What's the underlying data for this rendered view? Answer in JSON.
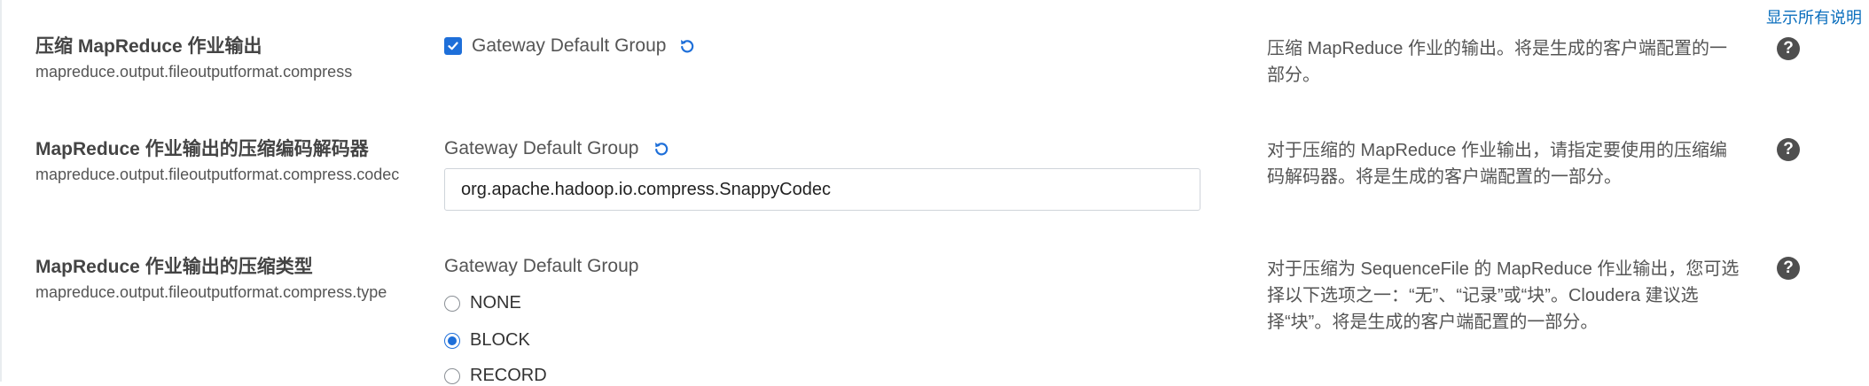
{
  "top_link": "显示所有说明",
  "colors": {
    "accent": "#1e6fd9",
    "link": "#0a6ebd",
    "help_icon": "#4f4f4f"
  },
  "rows": [
    {
      "title": "压缩 MapReduce 作业输出",
      "key": "mapreduce.output.fileoutputformat.compress",
      "group": "Gateway Default Group",
      "control": "checkbox",
      "checked": true,
      "description": "压缩 MapReduce 作业的输出。将是生成的客户端配置的一部分。"
    },
    {
      "title": "MapReduce 作业输出的压缩编码解码器",
      "key": "mapreduce.output.fileoutputformat.compress.codec",
      "group": "Gateway Default Group",
      "control": "text",
      "value": "org.apache.hadoop.io.compress.SnappyCodec",
      "description": "对于压缩的 MapReduce 作业输出，请指定要使用的压缩编码解码器。将是生成的客户端配置的一部分。"
    },
    {
      "title": "MapReduce 作业输出的压缩类型",
      "key": "mapreduce.output.fileoutputformat.compress.type",
      "group": "Gateway Default Group",
      "control": "radio",
      "options": [
        "NONE",
        "BLOCK",
        "RECORD"
      ],
      "selected": "BLOCK",
      "description": "对于压缩为 SequenceFile 的 MapReduce 作业输出，您可选择以下选项之一：“无”、“记录”或“块”。Cloudera 建议选择“块”。将是生成的客户端配置的一部分。"
    }
  ]
}
